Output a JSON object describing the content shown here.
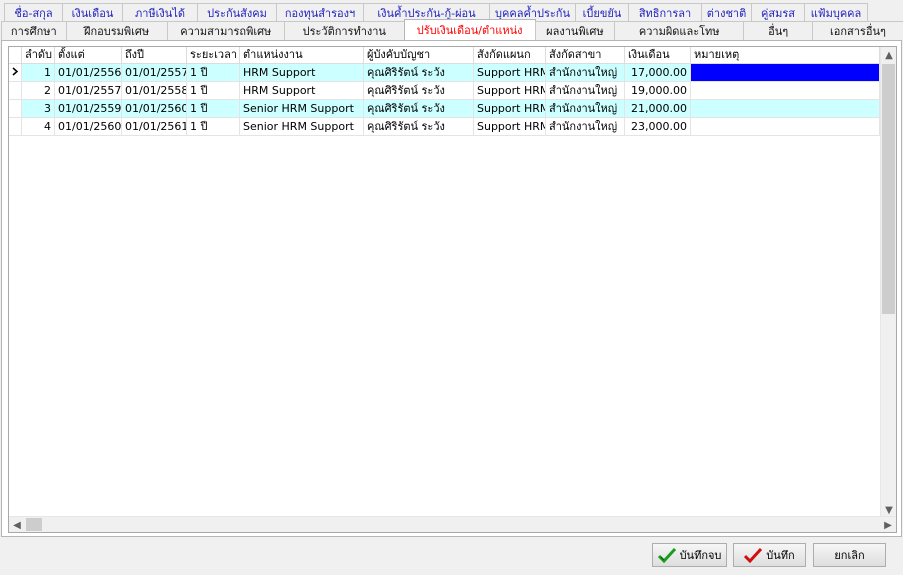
{
  "tabs_row1": [
    "ชื่อ-สกุล",
    "เงินเดือน",
    "ภาษีเงินได้",
    "ประกันสังคม",
    "กองทุนสำรองฯ",
    "เงินค้ำประกัน-กู้-ผ่อน",
    "บุคคลค้ำประกัน",
    "เบี้ยขยัน",
    "สิทธิการลา",
    "ต่างชาติ",
    "คู่สมรส",
    "แฟ้มบุคคล"
  ],
  "tabs_row2": [
    "การศึกษา",
    "ฝึกอบรมพิเศษ",
    "ความสามารถพิเศษ",
    "ประวัติการทำงาน",
    "ปรับเงินเดือน/ตำแหน่ง",
    "ผลงานพิเศษ",
    "ความผิดและโทษ",
    "อื่นๆ",
    "เอกสารอื่นๆ"
  ],
  "active_tab": "ปรับเงินเดือน/ตำแหน่ง",
  "columns": [
    "ลำดับ",
    "ตั้งแต่",
    "ถึงปี",
    "ระยะเวลา",
    "ตำแหน่งงาน",
    "ผู้บังคับบัญชา",
    "สังกัดแผนก",
    "สังกัดสาขา",
    "เงินเดือน",
    "หมายเหตุ"
  ],
  "rows": [
    {
      "no": "1",
      "from": "01/01/2556",
      "to": "01/01/2557",
      "period": "1 ปี",
      "position": "HRM Support",
      "supervisor": "คุณศิริรัตน์ ระวัง",
      "dept": "Support HRM",
      "branch": "สำนักงานใหญ่",
      "salary": "17,000.00",
      "note": ""
    },
    {
      "no": "2",
      "from": "01/01/2557",
      "to": "01/01/2558",
      "period": "1 ปี",
      "position": "HRM Support",
      "supervisor": "คุณศิริรัตน์ ระวัง",
      "dept": "Support HRM",
      "branch": "สำนักงานใหญ่",
      "salary": "19,000.00",
      "note": ""
    },
    {
      "no": "3",
      "from": "01/01/2559",
      "to": "01/01/2560",
      "period": "1 ปี",
      "position": "Senior HRM Support",
      "supervisor": "คุณศิริรัตน์ ระวัง",
      "dept": "Support HRM",
      "branch": "สำนักงานใหญ่",
      "salary": "21,000.00",
      "note": ""
    },
    {
      "no": "4",
      "from": "01/01/2560",
      "to": "01/01/2561",
      "period": "1 ปี",
      "position": "Senior HRM Support",
      "supervisor": "คุณศิริรัตน์ ระวัง",
      "dept": "Support HRM",
      "branch": "สำนักงานใหญ่",
      "salary": "23,000.00",
      "note": ""
    }
  ],
  "buttons": {
    "save_close": "บันทึกจบ",
    "save": "บันทึก",
    "cancel": "ยกเลิก"
  },
  "colors": {
    "active_tab_text": "#ff0000",
    "tab_row1_text": "#2222c0",
    "alt_row": "#ccffff",
    "selected_cell": "#0000ff"
  }
}
